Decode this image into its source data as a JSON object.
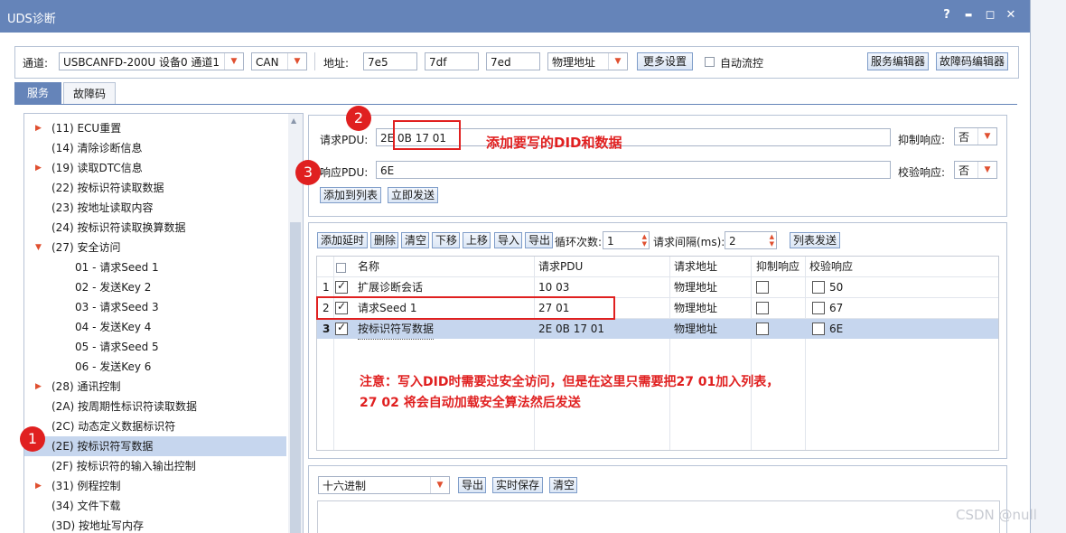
{
  "window": {
    "title": "UDS诊断",
    "controls": {
      "help": "?",
      "minimize": "▬",
      "maximize": "◻",
      "close": "✕"
    }
  },
  "toolbar": {
    "channel_label": "通道:",
    "channel_value": "USBCANFD-200U 设备0 通道1",
    "protocol_value": "CAN",
    "address_label": "地址:",
    "addr1": "7e5",
    "addr2": "7df",
    "addr3": "7ed",
    "addr_type": "物理地址",
    "more_settings": "更多设置",
    "auto_flow_label": "自动流控",
    "service_editor": "服务编辑器",
    "dtc_editor": "故障码编辑器"
  },
  "tabs": [
    {
      "label": "服务"
    },
    {
      "label": "故障码"
    }
  ],
  "tree": [
    {
      "label": "(11) ECU重置",
      "expandable": true
    },
    {
      "label": "(14) 清除诊断信息",
      "expandable": false
    },
    {
      "label": "(19) 读取DTC信息",
      "expandable": true
    },
    {
      "label": "(22) 按标识符读取数据",
      "expandable": false
    },
    {
      "label": "(23) 按地址读取内容",
      "expandable": false
    },
    {
      "label": "(24) 按标识符读取换算数据",
      "expandable": false
    },
    {
      "label": "(27) 安全访问",
      "expandable": true,
      "expanded": true
    },
    {
      "label": "01 - 请求Seed 1",
      "child": true
    },
    {
      "label": "02 - 发送Key 2",
      "child": true
    },
    {
      "label": "03 - 请求Seed 3",
      "child": true
    },
    {
      "label": "04 - 发送Key 4",
      "child": true
    },
    {
      "label": "05 - 请求Seed 5",
      "child": true
    },
    {
      "label": "06 - 发送Key 6",
      "child": true
    },
    {
      "label": "(28) 通讯控制",
      "expandable": true
    },
    {
      "label": "(2A) 按周期性标识符读取数据",
      "expandable": false
    },
    {
      "label": "(2C) 动态定义数据标识符",
      "expandable": false
    },
    {
      "label": "(2E) 按标识符写数据",
      "expandable": false,
      "selected": true
    },
    {
      "label": "(2F) 按标识符的输入输出控制",
      "expandable": false
    },
    {
      "label": "(31) 例程控制",
      "expandable": true
    },
    {
      "label": "(34) 文件下载",
      "expandable": false
    },
    {
      "label": "(3D) 按地址写内存",
      "expandable": false
    }
  ],
  "request": {
    "pdu_label": "请求PDU:",
    "pdu_value": "2E 0B 17 01",
    "suppress_label": "抑制响应:",
    "suppress_value": "否",
    "resp_label": "响应PDU:",
    "resp_value": "6E",
    "verify_label": "校验响应:",
    "verify_value": "否",
    "add_to_list": "添加到列表",
    "send_now": "立即发送"
  },
  "list_toolbar": {
    "add_delay": "添加延时",
    "delete": "删除",
    "clear": "清空",
    "move_down": "下移",
    "move_up": "上移",
    "import": "导入",
    "export": "导出",
    "loop_label": "循环次数:",
    "loop_value": "1",
    "interval_label": "请求间隔(ms):",
    "interval_value": "2",
    "list_send": "列表发送"
  },
  "grid": {
    "headers": [
      "名称",
      "请求PDU",
      "请求地址",
      "抑制响应",
      "校验响应"
    ],
    "rows": [
      {
        "num": "1",
        "name": "扩展诊断会话",
        "pdu": "10 03",
        "addr": "物理地址",
        "verify": "50",
        "checked": true
      },
      {
        "num": "2",
        "name": "请求Seed 1",
        "pdu": "27 01",
        "addr": "物理地址",
        "verify": "67",
        "checked": true
      },
      {
        "num": "3",
        "name": "按标识符写数据",
        "pdu": "2E 0B 17 01",
        "addr": "物理地址",
        "verify": "6E",
        "checked": true,
        "selected": true
      }
    ]
  },
  "bottom": {
    "format": "十六进制",
    "export": "导出",
    "realtime_save": "实时保存",
    "clear": "清空"
  },
  "annotations": {
    "c1": "1",
    "c2": "2",
    "c3": "3",
    "did_note": "添加要写的DID和数据",
    "note_line1": "注意：写入DID时需要过安全访问，但是在这里只需要把27 01加入列表，",
    "note_line2": "27 02 将会自动加载安全算法然后发送"
  },
  "watermark": "CSDN @null"
}
